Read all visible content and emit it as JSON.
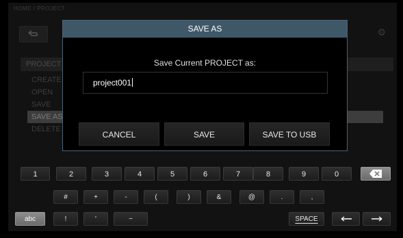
{
  "background": {
    "breadcrumb": "HOME / PROJECT",
    "menu_title": "PROJECT",
    "items": [
      "CREATE",
      "OPEN",
      "SAVE",
      "SAVE AS",
      "DELETE"
    ],
    "selected_index": 3
  },
  "dialog": {
    "title": "SAVE AS",
    "prompt": "Save Current PROJECT as:",
    "field_value": "project001",
    "buttons": {
      "cancel": "CANCEL",
      "save": "SAVE",
      "save_usb": "SAVE TO USB"
    }
  },
  "keyboard": {
    "row1": [
      "1",
      "2",
      "3",
      "4",
      "5",
      "6",
      "7",
      "8",
      "9",
      "0"
    ],
    "row2": [
      "#",
      "+",
      "-",
      "(",
      ")",
      "&",
      "@",
      ".",
      ","
    ],
    "row3": [
      "!",
      "'",
      "~"
    ],
    "mode_key": "abc",
    "space_key": "SPACE",
    "icons": {
      "backspace": "backspace-icon",
      "left": "arrow-left-icon",
      "right": "arrow-right-icon",
      "back": "back-arrow-icon",
      "settings": "gear-icon"
    }
  }
}
